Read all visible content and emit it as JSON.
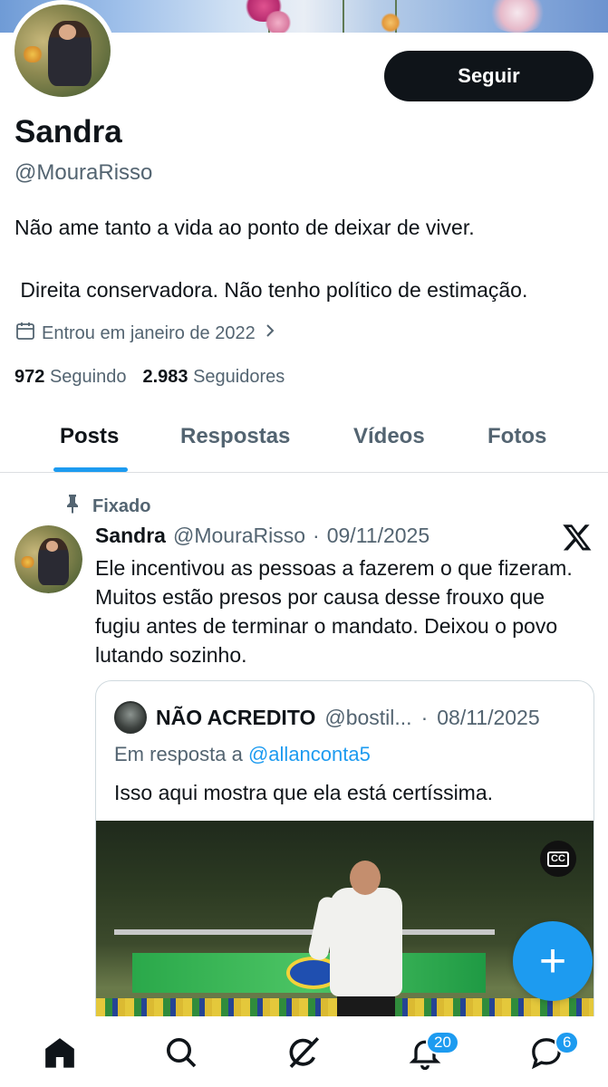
{
  "profile": {
    "name": "Sandra",
    "handle": "@MouraRisso",
    "bio_line1": "Não ame tanto a vida ao ponto de deixar de viver.",
    "bio_line2": " Direita conservadora. Não tenho político de estimação.",
    "joined": "Entrou em janeiro de 2022",
    "following_count": "972",
    "following_label": "Seguindo",
    "followers_count": "2.983",
    "followers_label": "Seguidores",
    "follow_label": "Seguir"
  },
  "tabs": [
    {
      "label": "Posts",
      "active": true
    },
    {
      "label": "Respostas",
      "active": false
    },
    {
      "label": "Vídeos",
      "active": false
    },
    {
      "label": "Fotos",
      "active": false
    }
  ],
  "post": {
    "pinned_label": "Fixado",
    "author_name": "Sandra",
    "author_handle": "@MouraRisso",
    "separator": "·",
    "date": "09/11/2025",
    "text": "Ele incentivou as pessoas a fazerem o que fizeram. Muitos estão presos por causa desse frouxo que fugiu antes de terminar o mandato. Deixou o povo lutando sozinho."
  },
  "quote": {
    "author_name": "NÃO ACREDITO",
    "author_handle": "@bostil...",
    "separator": "·",
    "date": "08/11/2025",
    "reply_prefix": "Em resposta a",
    "reply_to": "@allanconta5",
    "text": "Isso aqui mostra que ela está certíssima.",
    "cc_label": "CC"
  },
  "fab_label": "+",
  "nav": {
    "notifications_badge": "20",
    "messages_badge": "6"
  },
  "colors": {
    "accent": "#1d9bf0",
    "text_primary": "#0f1419",
    "text_secondary": "#536471",
    "button_dark": "#0f1419"
  },
  "icons": [
    "calendar-icon",
    "chevron-right-icon",
    "pin-icon",
    "x-logo-icon",
    "home-icon",
    "search-icon",
    "grok-icon",
    "bell-icon",
    "messages-icon",
    "plus-icon",
    "closed-captions-icon"
  ]
}
